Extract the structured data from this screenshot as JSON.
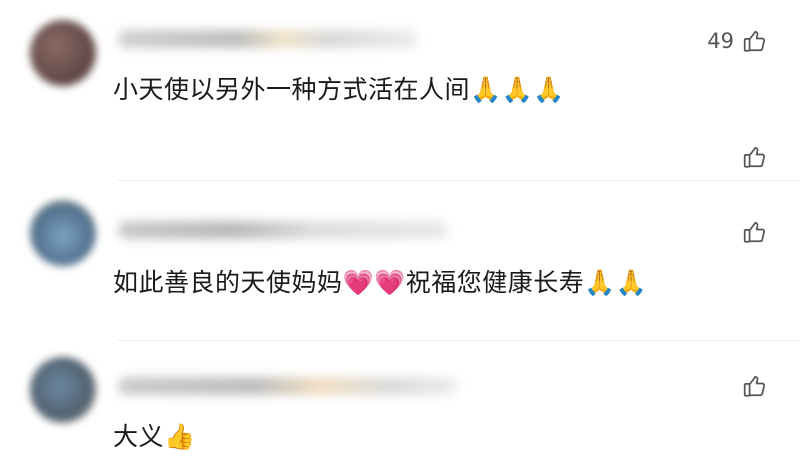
{
  "comments": [
    {
      "text": "小天使以另外一种方式活在人间🙏🙏🙏",
      "like_count": "49"
    },
    {
      "text": "",
      "like_count": ""
    },
    {
      "text": "如此善良的天使妈妈💗💗祝福您健康长寿🙏🙏",
      "like_count": ""
    },
    {
      "text": "大义👍",
      "like_count": ""
    }
  ],
  "icons": {
    "like": "thumbs-up-icon"
  },
  "colors": {
    "text": "#1a1a1a",
    "icon": "#555555",
    "divider": "#ececec"
  }
}
